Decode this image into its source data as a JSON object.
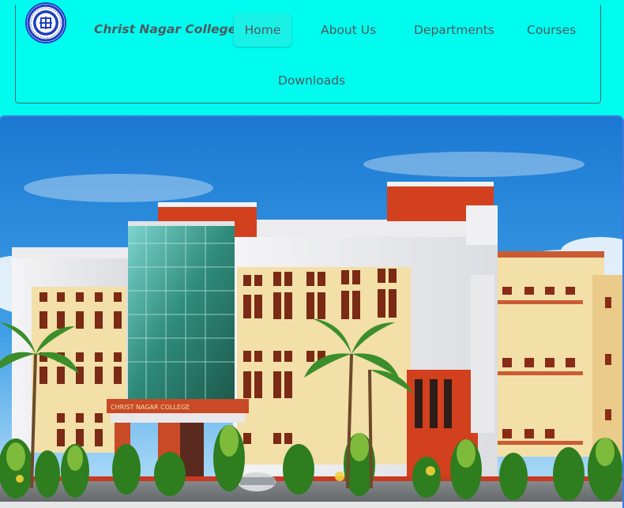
{
  "brand": {
    "name": "Christ Nagar College",
    "logo_icon": "college-emblem-icon"
  },
  "nav": {
    "items": [
      {
        "label": "Home",
        "active": true
      },
      {
        "label": "About Us",
        "active": false
      },
      {
        "label": "Departments",
        "active": false
      },
      {
        "label": "Courses",
        "active": false
      },
      {
        "label": "Downloads",
        "active": false
      }
    ]
  },
  "hero": {
    "building_sign": "CHRIST NAGAR COLLEGE"
  },
  "colors": {
    "page_background": "#00fcee",
    "nav_text": "#4e5960",
    "active_tab": "#19f0e6",
    "sky": "#1b7fd6",
    "building_red": "#d2401e",
    "building_cream": "#f3dfa8"
  }
}
